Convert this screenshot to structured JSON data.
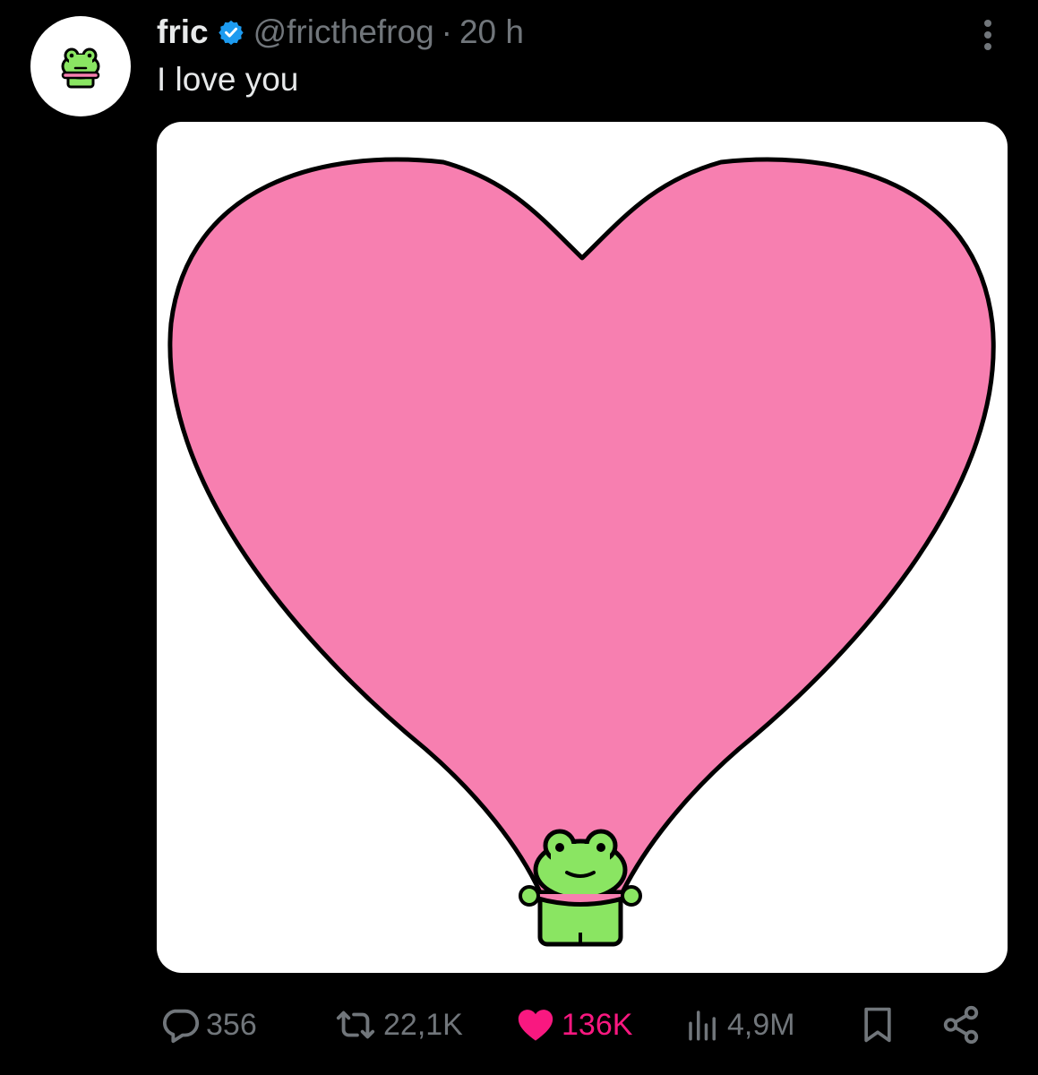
{
  "post": {
    "author": {
      "name": "fric",
      "handle": "@fricthefrog",
      "verified": true,
      "avatar_icon": "frog-avatar-icon"
    },
    "separator": "·",
    "time": "20 h",
    "text": "I love you",
    "media": {
      "icon": "heart-frog-illustration",
      "heart_color": "#f77fb0",
      "frog_color": "#8ae562"
    },
    "actions": {
      "replies": {
        "icon": "reply-icon",
        "count": "356"
      },
      "reposts": {
        "icon": "repost-icon",
        "count": "22,1K"
      },
      "likes": {
        "icon": "heart-icon",
        "count": "136K",
        "liked": true,
        "color": "#f91880"
      },
      "views": {
        "icon": "views-icon",
        "count": "4,9M"
      },
      "bookmark": {
        "icon": "bookmark-icon"
      },
      "share": {
        "icon": "share-icon"
      }
    }
  },
  "colors": {
    "background": "#000000",
    "text_primary": "#e7e9ea",
    "text_secondary": "#71767b",
    "verified_blue": "#1d9bf0",
    "like_pink": "#f91880"
  }
}
